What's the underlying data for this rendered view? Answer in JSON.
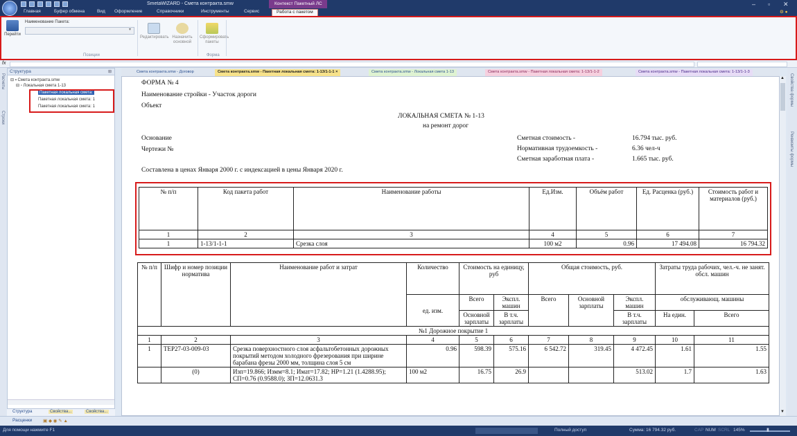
{
  "app": {
    "title": "SmetaWIZARD - Смета контракта.smw",
    "context_tab": "Контекст Пакетный ЛС"
  },
  "menu": {
    "items": [
      "Главная",
      "Буфер обмена",
      "Вид",
      "Оформление",
      "Справочники",
      "Инструменты",
      "Сервис"
    ],
    "active": "Работа с пакетом"
  },
  "ribbon": {
    "goto": "Перейти",
    "package_name_label": "Наименование Пакета:",
    "edit": "Редактировать",
    "assign_main": "Назначить основной",
    "form_packages": "Сформировать пакеты",
    "group_positions": "Позиции",
    "group_form": "Форма"
  },
  "left_panel": {
    "header": "Структура",
    "root": "Смета контракта.smw",
    "child": "Локальная смета 1-13",
    "items": [
      "Пакетная локальная смета:",
      "Пакетная локальная смета: 1",
      "Пакетная локальная смета: 1"
    ],
    "tabs": [
      "Структура",
      "Свойства...",
      "Свойства..."
    ]
  },
  "side_tabs": {
    "left": [
      "Расчеты",
      "Строки"
    ],
    "right": [
      "Свойства формы",
      "Реквизиты формы"
    ]
  },
  "doc_tabs": [
    "Смета контракта.smw - Договор",
    "Смета контракта.smw - Пакетная локальная смета: 1-13/1-1-1",
    "Смета контракта.smw - Локальная смета 1-13",
    "Смета контракта.smw - Пакетная локальная смета: 1-13/1-1-2",
    "Смета контракта.smw - Пакетная локальная смета: 1-13/1-1-3"
  ],
  "doc": {
    "form": "ФОРМА № 4",
    "construction": "Наименование стройки - Участок дороги",
    "object": "Объект",
    "title": "ЛОКАЛЬНАЯ СМЕТА № 1-13",
    "subtitle": "на ремонт дорог",
    "basis": "Основание",
    "drawings": "Чертежи №",
    "cost_label": "Сметная стоимость -",
    "cost_value": "16.794 тыс. руб.",
    "labor_label": "Нормативная трудоемкость -",
    "labor_value": "6.36 чел-ч",
    "salary_label": "Сметная заработная плата -",
    "salary_value": "1.665 тыс. руб.",
    "prices_note": "Составлена в ценах Января 2000 г. с индексацией в цены Января 2020 г."
  },
  "table1": {
    "headers": [
      "№ п/п",
      "Код пакета работ",
      "Наименование работы",
      "Ед.Изм.",
      "Объём работ",
      "Ед. Расценка (руб.)",
      "Стоимость работ и материалов (руб.)"
    ],
    "nums": [
      "1",
      "2",
      "3",
      "4",
      "5",
      "6",
      "7"
    ],
    "row": [
      "1",
      "1-13/1-1-1",
      "Срезка слоя",
      "100 м2",
      "0.96",
      "17 494.08",
      "16 794.32"
    ]
  },
  "table2": {
    "h_num": "№ п/п",
    "h_code": "Шифр и номер позиции норматива",
    "h_name": "Наименование работ и затрат",
    "h_qty": "Количество",
    "h_unit": "ед. изм.",
    "h_unit_cost": "Стоимость на единицу, руб",
    "h_total": "Общая стоимость, руб.",
    "h_labor": "Затраты труда рабочих, чел.-ч. не занят. обсл. машин",
    "h_all": "Всего",
    "h_mach": "Экспл. машин",
    "h_main_sal": "Основной зарплаты",
    "h_incl_sal": "В т.ч. зарплаты",
    "h_all2": "Всего",
    "h_main_sal2": "Основной зарплаты",
    "h_mach2": "Экспл. машин",
    "h_serv": "обслуживающ. машины",
    "h_incl_sal2": "В т.ч. зарплаты",
    "h_per_unit": "На един.",
    "h_all3": "Всего",
    "nums": [
      "1",
      "2",
      "3",
      "4",
      "5",
      "6",
      "7",
      "8",
      "9",
      "10",
      "11"
    ],
    "section": "№1 Дорожное покрытие 1",
    "row1": [
      "1",
      "ТЕР27-03-009-03",
      "Срезка поверхностного слоя асфальтобетонных дорожных покрытий методом холодного фрезерования при ширине барабана фрезы 2000 мм, толщина слоя 5 см",
      "0.96",
      "598.39",
      "575.16",
      "6 542.72",
      "319.45",
      "4 472.45",
      "1.61",
      "1.55"
    ],
    "row2": [
      "(0)",
      "Изп=19.866; Измм=8.1; Имат=17.82; НР=1.21 (1.4288.95); СП=0.76 (0.9588.0); ЗП=12.0631.3",
      "100 м2",
      "16.75",
      "26.9",
      "513.02",
      "1.7",
      "1.63"
    ]
  },
  "bottom_strip": {
    "label": "Расценки"
  },
  "status": {
    "hint": "Для помощи нажмите F1",
    "access": "Полный доступ",
    "sum": "Сумма: 16 794.32 руб.",
    "caps": "CAP",
    "num": "NUM",
    "scrl": "SCRL",
    "zoom": "145%"
  }
}
